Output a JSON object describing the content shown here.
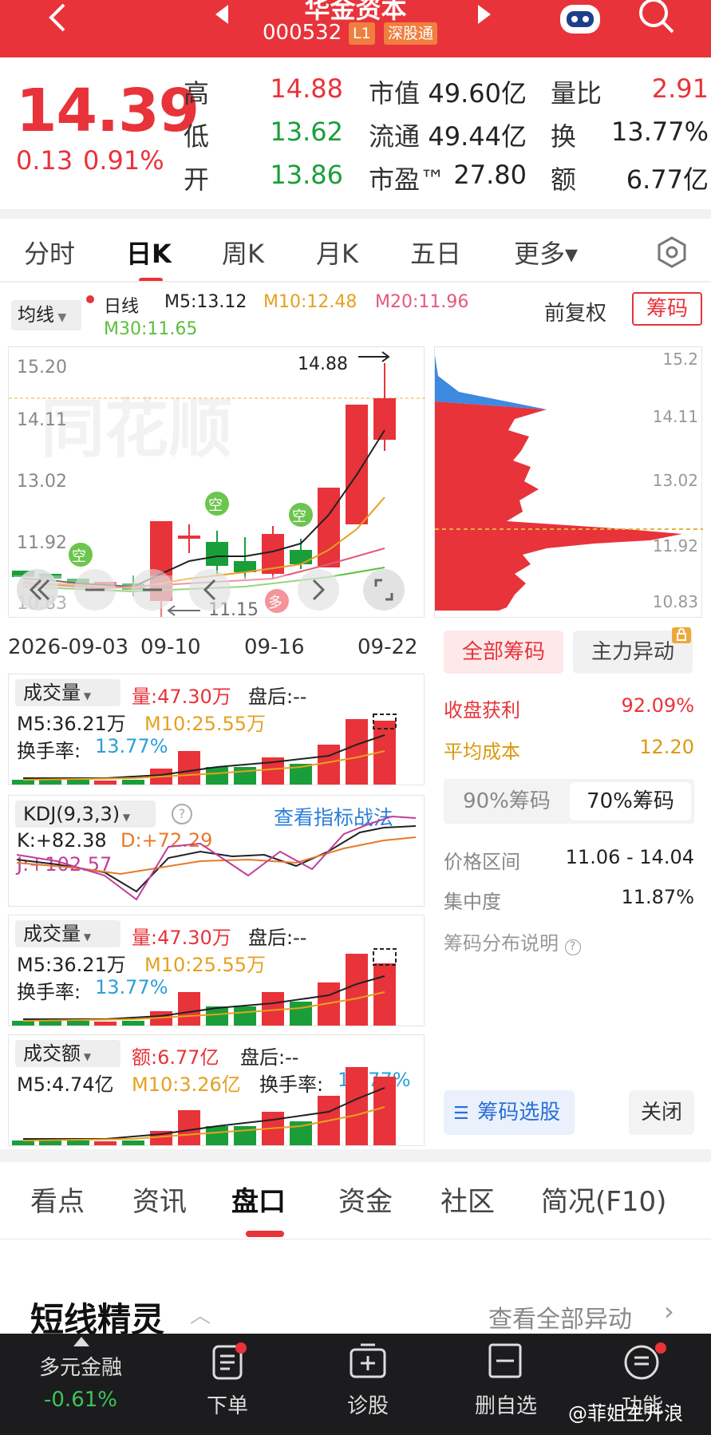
{
  "header": {
    "title": "华金资本",
    "code": "000532",
    "tag_level": "L1",
    "tag_connect": "深股通"
  },
  "quote": {
    "price": "14.39",
    "change": "0.13",
    "change_pct": "0.91%",
    "high_label": "高",
    "high": "14.88",
    "low_label": "低",
    "low": "13.62",
    "open_label": "开",
    "open": "13.86",
    "mcap_label": "市值",
    "mcap": "49.60亿",
    "float_label": "流通",
    "float": "49.44亿",
    "pe_label": "市盈™",
    "pe": "27.80",
    "vr_label": "量比",
    "vr": "2.91",
    "turnover_label": "换",
    "turnover": "13.77%",
    "amount_label": "额",
    "amount": "6.77亿"
  },
  "ktabs": [
    "分时",
    "日K",
    "周K",
    "月K",
    "五日",
    "更多▾"
  ],
  "ma_bar": {
    "mode": "均线",
    "line": "日线",
    "m5": "M5:13.12",
    "m10": "M10:12.48",
    "m20": "M20:11.96",
    "m30": "M30:11.65",
    "adjust": "前复权",
    "chips": "筹码"
  },
  "kline": {
    "y_ticks": [
      "15.20",
      "14.11",
      "13.02",
      "11.92",
      "10.83"
    ],
    "x_ticks": [
      "2026-09-03",
      "09-10",
      "09-16",
      "09-22"
    ],
    "high_mark": "14.88",
    "low_mark": "11.15",
    "empty_tag": "空",
    "long_tag": "多"
  },
  "chips": {
    "y_ticks": [
      "15.2",
      "14.11",
      "13.02",
      "11.92",
      "10.83"
    ],
    "tab_all": "全部筹码",
    "tab_main": "主力异动",
    "profit_label": "收盘获利",
    "profit": "92.09%",
    "cost_label": "平均成本",
    "cost": "12.20",
    "c90": "90%筹码",
    "c70": "70%筹码",
    "range_label": "价格区间",
    "range": "11.06 - 14.04",
    "conc_label": "集中度",
    "conc": "11.87%",
    "explain": "筹码分布说明",
    "select_btn": "筹码选股",
    "close_btn": "关闭"
  },
  "vol1": {
    "title": "成交量",
    "val": "量:47.30万",
    "after": "盘后:--",
    "m5": "M5:36.21万",
    "m10": "M10:25.55万",
    "turn_label": "换手率:",
    "turn": "13.77%"
  },
  "kdj": {
    "title": "KDJ(9,3,3)",
    "link": "查看指标战法",
    "k": "K:+82.38",
    "d": "D:+72.29",
    "j": "J:+102.57"
  },
  "vol2": {
    "title": "成交量",
    "val": "量:47.30万",
    "after": "盘后:--",
    "m5": "M5:36.21万",
    "m10": "M10:25.55万",
    "turn_label": "换手率:",
    "turn": "13.77%"
  },
  "amt": {
    "title": "成交额",
    "val": "额:6.77亿",
    "after": "盘后:--",
    "m5": "M5:4.74亿",
    "m10": "M10:3.26亿",
    "turn_label": "换手率:",
    "turn": "13.77%"
  },
  "btabs": [
    "看点",
    "资讯",
    "盘口",
    "资金",
    "社区",
    "简况(F10)"
  ],
  "spirit": {
    "title": "短线精灵",
    "link": "查看全部异动"
  },
  "bottom": {
    "index_name": "多元金融",
    "index_chg": "-0.61%",
    "order": "下单",
    "diagnose": "诊股",
    "remove": "删自选",
    "func": "功能",
    "watermark": "@菲姐主升浪"
  },
  "colors": {
    "up": "#e8333a",
    "down": "#1a9e3a",
    "accent": "#e8333a"
  }
}
